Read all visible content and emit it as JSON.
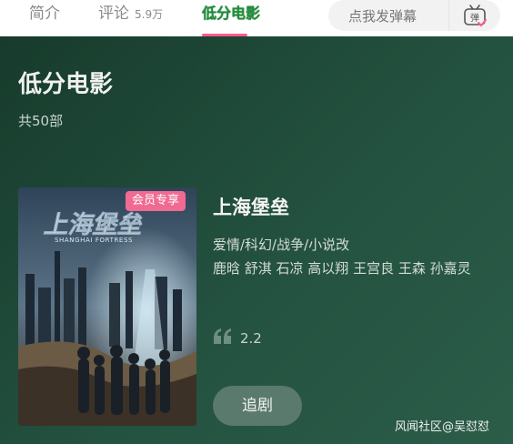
{
  "tabs": {
    "intro": "简介",
    "comments": "评论",
    "comments_count": "5.9万",
    "active": "低分电影"
  },
  "danmaku": {
    "placeholder": "点我发弹幕",
    "icon_text": "弹"
  },
  "section": {
    "title": "低分电影",
    "count": "共50部"
  },
  "movie": {
    "poster_badge": "会员专享",
    "poster_title": "上海堡垒",
    "poster_subtitle": "SHANGHAI FORTRESS",
    "title": "上海堡垒",
    "genre": "爱情/科幻/战争/小说改",
    "cast": "鹿晗 舒淇 石凉 高以翔 王宫良 王森 孙嘉灵",
    "rating": "2.2",
    "follow_label": "追剧"
  },
  "watermark": "风闻社区@吴怼怼",
  "colors": {
    "accent_pink": "#ff5c8a",
    "active_tab_green": "#1f8f3a",
    "panel_dark_green": "#1f4a38",
    "vip_badge": "#f06a92"
  }
}
